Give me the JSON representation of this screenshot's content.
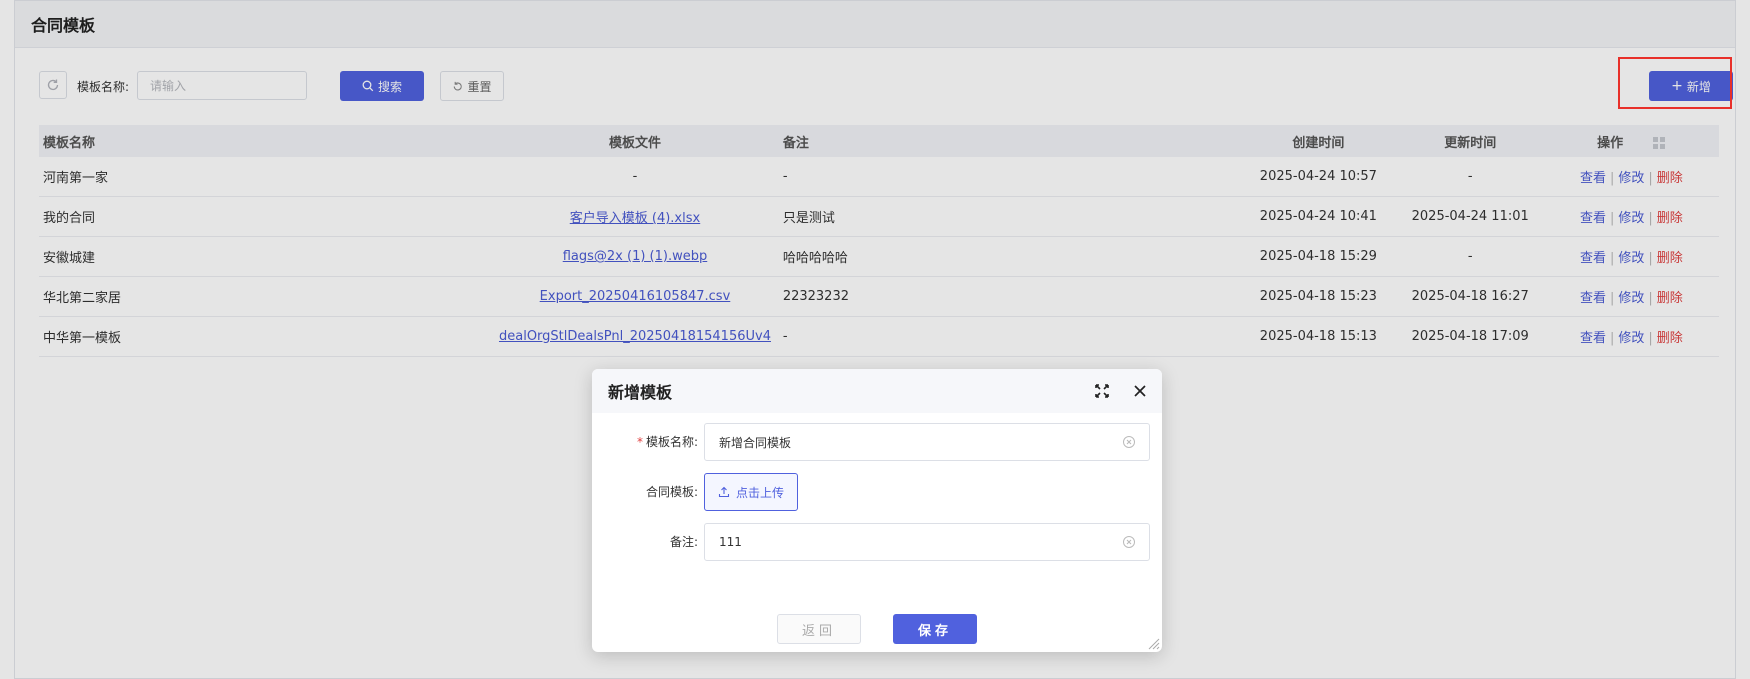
{
  "page": {
    "title": "合同模板"
  },
  "toolbar": {
    "search_label": "模板名称:",
    "search_placeholder": "请输入",
    "search_button": "搜索",
    "reset_button": "重置",
    "add_button": "新增"
  },
  "table": {
    "headers": {
      "name": "模板名称",
      "file": "模板文件",
      "note": "备注",
      "created": "创建时间",
      "updated": "更新时间",
      "ops": "操作"
    },
    "op_labels": {
      "view": "查看",
      "edit": "修改",
      "delete": "删除"
    },
    "rows": [
      {
        "name": "河南第一家",
        "file": "-",
        "note": "-",
        "created": "2025-04-24 10:57",
        "updated": "-"
      },
      {
        "name": "我的合同",
        "file": "客户导入模板 (4).xlsx",
        "note": "只是测试",
        "created": "2025-04-24 10:41",
        "updated": "2025-04-24 11:01"
      },
      {
        "name": "安徽城建",
        "file": "flags@2x (1) (1).webp",
        "note": "哈哈哈哈哈",
        "created": "2025-04-18 15:29",
        "updated": "-"
      },
      {
        "name": "华北第二家居",
        "file": "Export_20250416105847.csv",
        "note": "22323232",
        "created": "2025-04-18 15:23",
        "updated": "2025-04-18 16:27"
      },
      {
        "name": "中华第一模板",
        "file": "dealOrgStlDealsPnl_20250418154156Uv4",
        "note": "-",
        "created": "2025-04-18 15:13",
        "updated": "2025-04-18 17:09"
      }
    ]
  },
  "dialog": {
    "title": "新增模板",
    "name_label": "模板名称:",
    "name_value": "新增合同模板",
    "file_label": "合同模板:",
    "upload_label": "点击上传",
    "note_label": "备注:",
    "note_value": "111",
    "back_button": "返回",
    "save_button": "保存"
  },
  "colors": {
    "primary": "#5061de",
    "danger": "#e04040",
    "highlight": "#e8302a"
  }
}
